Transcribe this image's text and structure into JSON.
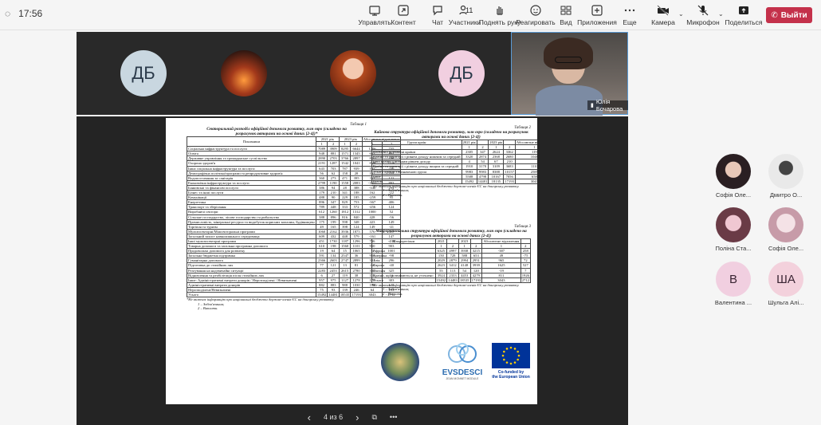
{
  "top": {
    "time": "17:56",
    "tools": [
      {
        "label": "Управлять",
        "icon": "monitor-pen-icon"
      },
      {
        "label": "Контент",
        "icon": "share-content-icon"
      },
      {
        "label": "Чат",
        "icon": "chat-icon"
      },
      {
        "label": "Участники",
        "icon": "people-icon",
        "count": "11"
      },
      {
        "label": "Поднять руку",
        "icon": "raise-hand-icon"
      },
      {
        "label": "Реагировать",
        "icon": "emoji-icon"
      },
      {
        "label": "Вид",
        "icon": "grid-view-icon"
      },
      {
        "label": "Приложения",
        "icon": "apps-plus-icon"
      },
      {
        "label": "Еще",
        "icon": "more-icon"
      },
      {
        "label": "Камера",
        "icon": "camera-off-icon"
      },
      {
        "label": "Микрофон",
        "icon": "mic-off-icon"
      },
      {
        "label": "Поделиться",
        "icon": "share-tray-icon"
      }
    ],
    "leave": "Выйти"
  },
  "gallery": {
    "t1": "ДБ",
    "t4": "ДБ",
    "speaker": "Юлія Бочарова"
  },
  "doc": {
    "t1": {
      "caption": "Таблиця 1",
      "title": "Секторальний розподіл офіційної допомоги розвитку, млн євро (складено на",
      "title2": "розрахунок авторами на основі даних [2-4])*",
      "h1": "Показники",
      "h2": "2021 рік",
      "h3": "2023 рік",
      "h4": "Абсолютне відхилення",
      "sub": [
        "1",
        "2",
        "1",
        "2",
        "1",
        "2"
      ],
      "rows": [
        [
          "Соціальна інфраструктура та послуги",
          "7089",
          "3909",
          "8295",
          "6644",
          "1206",
          "735"
        ],
        [
          "Освіта",
          "948",
          "881",
          "1571",
          "1345",
          "623",
          "464"
        ],
        [
          "Державне управління та громадянське суспільство",
          "2890",
          "2703",
          "3766",
          "2897",
          "876",
          "194"
        ],
        [
          "Охорона здоров'я",
          "2191",
          "1287",
          "1542",
          "1041",
          "-649",
          "-246"
        ],
        [
          "Інша соціальна інфраструктура та послуги",
          "643",
          "703",
          "787",
          "939",
          "144",
          "236"
        ],
        [
          "Демографічна політика/програми та репродуктивне здоров'я",
          "56",
          "62",
          "158",
          "28",
          "102",
          "-34"
        ],
        [
          "Водопостачання та санітарія",
          "360",
          "273",
          "471",
          "395",
          "111",
          "122"
        ],
        [
          "Економічна інфраструктура та послуги",
          "2799",
          "1190",
          "1558",
          "2083",
          "-1241",
          "893"
        ],
        [
          "Банківські та фінансові послуги",
          "386",
          "94",
          "28",
          "388",
          "-340",
          "294"
        ],
        [
          "Бізнес та інші послуги",
          "179",
          "210",
          "341",
          "188",
          "162",
          "-22"
        ],
        [
          "Комунікації",
          "488",
          "90",
          "229",
          "185",
          "-259",
          "95"
        ],
        [
          "Енергетика",
          "896",
          "347",
          "829",
          "753",
          "-367",
          "406"
        ],
        [
          "Транспорт та зберігання",
          "789",
          "448",
          "333",
          "572",
          "-456",
          "124"
        ],
        [
          "Виробничі сектори",
          "612",
          "1260",
          "1812",
          "1312",
          "1000",
          "52"
        ],
        [
          "Сільське господарство, лісове господарство та рибальство",
          "388",
          "896",
          "816",
          "840",
          "428",
          "-56"
        ],
        [
          "Промисловість, мінеральні ресурси та видобуток корисних копалин, будівництво",
          "175",
          "199",
          "598",
          "348",
          "423",
          "149"
        ],
        [
          "Торгівля та туризм",
          "49",
          "165",
          "398",
          "124",
          "149",
          "-41"
        ],
        [
          "Мультисекторні/Міжсекторальні програми",
          "1060",
          "2162",
          "3936",
          "1875",
          "576",
          "-287"
        ],
        [
          "Загальний захист навколишнього середовища",
          "609",
          "432",
          "448",
          "579",
          "-161",
          "147"
        ],
        [
          "Інші мультисекторні програми",
          "451",
          "1730",
          "1187",
          "1296",
          "736",
          "-434"
        ],
        [
          "Товарна допомога та загальна програмна допомога",
          "610",
          "198",
          "1560",
          "1101",
          "950",
          "903"
        ],
        [
          "Продовольча допомога для розвитку",
          "19",
          "64",
          "15",
          "1065",
          "-4",
          "1001"
        ],
        [
          "Загальна бюджетна підтримка",
          "591",
          "134",
          "2547",
          "36",
          "956",
          "-98"
        ],
        [
          "Гуманітарна допомога",
          "2366",
          "2603",
          "2747",
          "2899",
          "381",
          "296"
        ],
        [
          "Підготовка до стихійних лих",
          "77",
          "121",
          "13",
          "81",
          "-64",
          "-40"
        ],
        [
          "Реагування на надзвичайні ситуації",
          "2283",
          "2453",
          "2615",
          "2780",
          "332",
          "325"
        ],
        [
          "Відновлення та реабілітація після стихійних лих",
          "6",
          "27",
          "119",
          "38",
          "113",
          "11"
        ],
        [
          "Інше: Адміністративні витрати донорів / Нерозподілені / Невизначені",
          "957",
          "975",
          "1127",
          "1278",
          "170",
          "303"
        ],
        [
          "Адміністративні витрати донорів",
          "882",
          "883",
          "988",
          "1030",
          "106",
          "147"
        ],
        [
          "Нерозподілені/Невизначені",
          "75",
          "93",
          "139",
          "246",
          "64",
          "153"
        ],
        [
          "Усього",
          "15492",
          "14481",
          "18535",
          "17193",
          "3043",
          "2712"
        ]
      ],
      "n1": "*Не включає інформацію про національні бюджети держав-членів ЄС на донорську розвитку.",
      "n2": "1 – Зобов'язання;",
      "n3": "2 – Виплати."
    },
    "t2": {
      "caption": "Таблиця 2",
      "title": "Кайнова структура офіційної допомоги розвитку, млн євро (складено на розрахунок авторами на основі даних [2-4])",
      "h": [
        "Групи країн",
        "2021 рік",
        "",
        "2023 рік",
        "",
        "Абсолютне відхилення",
        ""
      ],
      "sub": [
        "",
        "1",
        "2",
        "1",
        "2",
        "1",
        "2"
      ],
      "rows": [
        [
          "Найменш розвинені країни",
          "2305",
          "347",
          "2624",
          "3362",
          "119",
          "3215"
        ],
        [
          "Країни та території з рівнем доходу нижчим за середній",
          "3320",
          "2874",
          "2368",
          "2680",
          "1048",
          "-194"
        ],
        [
          "Інші країни з низьким рівнем доходу",
          "4",
          "54",
          "67",
          "210",
          "",
          "158"
        ],
        [
          "Країни та території з рівнем доходу вищим за середній",
          "1910",
          "3170",
          "3109",
          "3683",
          "1110",
          "469"
        ],
        [
          "Усього країни з визначеною групи",
          "9983",
          "9983",
          "8388",
          "10157",
          "2585",
          "452"
        ],
        [
          "Інше",
          "5508",
          "4798",
          "10167",
          "7056",
          "658",
          "2260"
        ],
        [
          "Разом",
          "15492",
          "14481",
          "18135",
          "17193",
          "3043",
          "2712"
        ]
      ],
      "n1": "*Не включає інформацію про національні бюджети держав-членів ЄС на донорську розвитку.",
      "n2": "1 – Зобов'язання;",
      "n3": "2 – Виплати."
    },
    "t3": {
      "caption": "Таблиця 3",
      "title": "Макрорегіональна структура офіційної допомоги розвитку, млн євро (складено на розрахунок авторами на основі даних [2-4])",
      "h": [
        "Макрорегіони",
        "2021",
        "",
        "2023",
        "",
        "Абсолютне відхилення",
        ""
      ],
      "sub": [
        "",
        "1",
        "2",
        "1",
        "2",
        "1",
        "2"
      ],
      "rows": [
        [
          "Африка",
          "6325",
          "4997",
          "3938",
          "3215",
          "-387",
          "258"
        ],
        [
          "Америка",
          "150",
          "728",
          "588",
          "653",
          "49",
          "-75"
        ],
        [
          "Азія",
          "2029",
          "2879",
          "2994",
          "2951",
          "965",
          "72"
        ],
        [
          "Європа",
          "2623",
          "3412",
          "4148",
          "3939",
          "1625",
          "527"
        ],
        [
          "Океанія",
          "55",
          "113",
          "54",
          "120",
          "-19",
          "7"
        ],
        [
          "Країни, що розвиваються, не уточнено",
          "3924",
          "2333",
          "4453",
          "4279",
          "811",
          "1926"
        ],
        [
          "Усього",
          "15492",
          "14483",
          "18535",
          "17193",
          "3043",
          "2712"
        ]
      ],
      "n1": "*Не включає інформацію про національні бюджети держав-членів ЄС на донорську розвитку.",
      "n2": "1 – Зобов'язання;",
      "n3": "2 – Виплати."
    },
    "logos": {
      "evs": "EVSDESCI",
      "evs_sub": "JEAN MONNET MODULE",
      "eu1": "Co-funded by",
      "eu2": "the European Union"
    }
  },
  "docbar": {
    "page": "4 из 6"
  },
  "roster": [
    {
      "name": "Софія Оле...",
      "kind": "photo"
    },
    {
      "name": "Дмитро О...",
      "kind": "photo"
    },
    {
      "name": "Поліна Ста...",
      "kind": "photo"
    },
    {
      "name": "Софія Оле...",
      "kind": "photo"
    },
    {
      "name": "Валентина ...",
      "kind": "initials",
      "initials": "В",
      "color": "#f1cfe0"
    },
    {
      "name": "Шульга Алі...",
      "kind": "initials",
      "initials": "ША",
      "color": "#f3d1dc"
    }
  ]
}
